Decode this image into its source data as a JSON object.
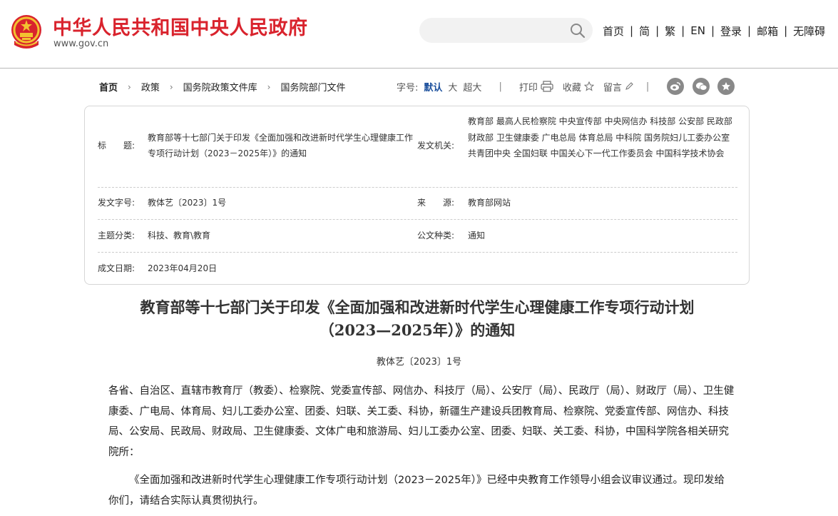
{
  "header": {
    "site_title": "中华人民共和国中央人民政府",
    "site_url": "www.gov.cn",
    "search_placeholder": "",
    "nav": [
      "首页",
      "简",
      "繁",
      "EN",
      "登录",
      "邮箱",
      "无障碍"
    ]
  },
  "breadcrumb": [
    "首页",
    "政策",
    "国务院政策文件库",
    "国务院部门文件"
  ],
  "toolbar": {
    "font_label": "字号:",
    "font_sizes": [
      "默认",
      "大",
      "超大"
    ],
    "print": "打印",
    "favorite": "收藏",
    "comment": "留言"
  },
  "share_icons": [
    "weibo-icon",
    "wechat-icon",
    "favorite-star-icon"
  ],
  "info": {
    "title_label": "标　　题:",
    "title_value": "教育部等十七部门关于印发《全面加强和改进新时代学生心理健康工作专项行动计划（2023－2025年）》的通知",
    "issuer_label": "发文机关:",
    "issuer_value": "教育部 最高人民检察院 中央宣传部 中央网信办 科技部 公安部 民政部 财政部 卫生健康委 广电总局 体育总局 中科院 国务院妇儿工委办公室 共青团中央 全国妇联 中国关心下一代工作委员会 中国科学技术协会",
    "docno_label": "发文字号:",
    "docno_value": "教体艺〔2023〕1号",
    "source_label": "来　　源:",
    "source_value": "教育部网站",
    "topic_label": "主题分类:",
    "topic_value": "科技、教育\\教育",
    "type_label": "公文种类:",
    "type_value": "通知",
    "date_label": "成文日期:",
    "date_value": "2023年04月20日"
  },
  "article": {
    "title_line1": "教育部等十七部门关于印发《全面加强和改进新时代学生心理健康工作专项行动计划",
    "title_line2": "（2023—2025年）》的通知",
    "docno": "教体艺〔2023〕1号",
    "para1": "各省、自治区、直辖市教育厅（教委）、检察院、党委宣传部、网信办、科技厅（局）、公安厅（局）、民政厅（局）、财政厅（局）、卫生健康委、广电局、体育局、妇儿工委办公室、团委、妇联、关工委、科协，新疆生产建设兵团教育局、检察院、党委宣传部、网信办、科技局、公安局、民政局、财政局、卫生健康委、文体广电和旅游局、妇儿工委办公室、团委、妇联、关工委、科协，中国科学院各相关研究院所：",
    "para2": "《全面加强和改进新时代学生心理健康工作专项行动计划（2023－2025年）》已经中央教育工作领导小组会议审议通过。现印发给你们，请结合实际认真贯彻执行。"
  },
  "colors": {
    "brand_red": "#d9232d",
    "active_blue": "#1b4f9c",
    "share_gray": "#898989"
  }
}
